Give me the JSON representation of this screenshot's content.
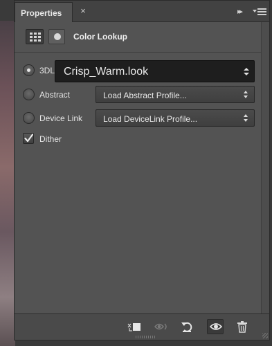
{
  "panel": {
    "tab_label": "Properties",
    "tab_close": "×",
    "collapse_glyph": "▸▸",
    "adjustment_title": "Color Lookup"
  },
  "options": {
    "lut_3d": {
      "label": "3DL",
      "selected": true,
      "value": "Crisp_Warm.look"
    },
    "abstract": {
      "label": "Abstract",
      "selected": false,
      "value": "Load Abstract Profile..."
    },
    "device_link": {
      "label": "Device Link",
      "selected": false,
      "value": "Load DeviceLink Profile..."
    },
    "dither": {
      "label": "Dither",
      "checked": true
    }
  },
  "footer": {
    "buttons": [
      "clip-to-layer",
      "view-previous-state",
      "reset-adjustment",
      "toggle-visibility",
      "delete-adjustment"
    ]
  },
  "colors": {
    "panel_bg": "#535353",
    "titlebar_bg": "#424242",
    "dropdown_bg": "#1e1e1e",
    "text": "#e6e6e6"
  }
}
